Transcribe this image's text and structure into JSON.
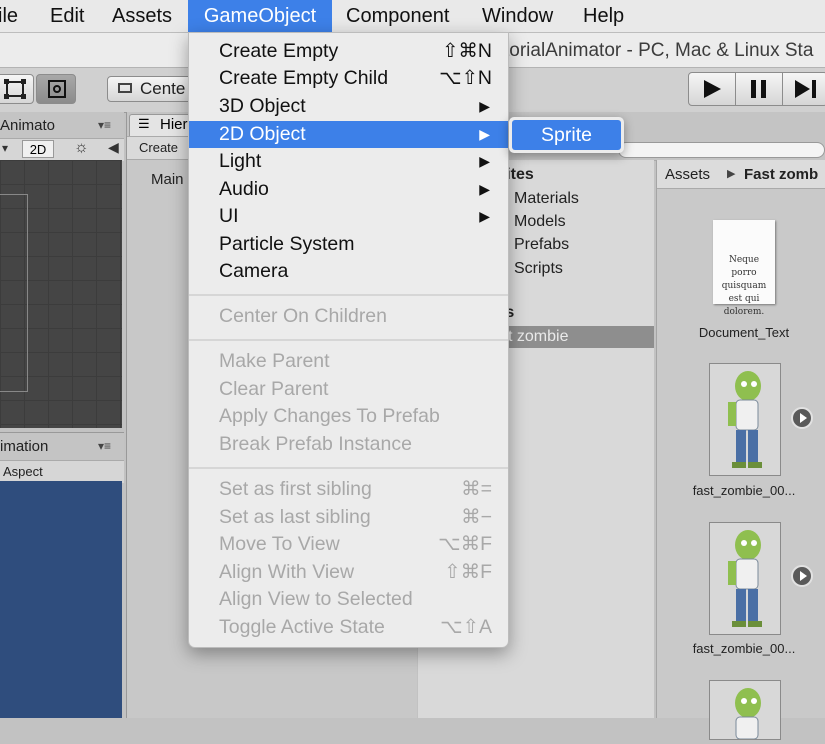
{
  "menubar": {
    "items": [
      "ile",
      "Edit",
      "Assets",
      "GameObject",
      "Component",
      "Window",
      "Help"
    ]
  },
  "window": {
    "title": "torialAnimator - PC, Mac & Linux Sta"
  },
  "toolbar": {
    "pivot_label": "Cente",
    "play_controls": [
      "play",
      "pause",
      "step"
    ]
  },
  "panels": {
    "animator_tab": "Animato",
    "animation_tab": "imation",
    "aspect_label": "Aspect",
    "scene_2d_button": "2D",
    "hierarchy_tab": "Hier",
    "hierarchy_create": "Create",
    "hierarchy_item": "Main"
  },
  "project": {
    "folders": [
      "rites",
      "Materials",
      "Models",
      "Prefabs",
      "Scripts",
      "ts",
      "st zombie"
    ],
    "breadcrumb": [
      "Assets",
      "Fast zomb"
    ],
    "assets": [
      {
        "name": "Document_Text",
        "preview_text": "Neque porro quisquam est qui dolorem."
      },
      {
        "name": "fast_zombie_00..."
      },
      {
        "name": "fast_zombie_00..."
      }
    ]
  },
  "gameobject_menu": {
    "items": [
      {
        "label": "Create Empty",
        "shortcut": "⇧⌘N",
        "enabled": true
      },
      {
        "label": "Create Empty Child",
        "shortcut": "⌥⇧N",
        "enabled": true
      },
      {
        "label": "3D Object",
        "submenu": true,
        "enabled": true
      },
      {
        "label": "2D Object",
        "submenu": true,
        "enabled": true,
        "highlighted": true
      },
      {
        "label": "Light",
        "submenu": true,
        "enabled": true
      },
      {
        "label": "Audio",
        "submenu": true,
        "enabled": true
      },
      {
        "label": "UI",
        "submenu": true,
        "enabled": true
      },
      {
        "label": "Particle System",
        "enabled": true
      },
      {
        "label": "Camera",
        "enabled": true
      },
      {
        "label": "Center On Children",
        "enabled": false
      },
      {
        "label": "Make Parent",
        "enabled": false
      },
      {
        "label": "Clear Parent",
        "enabled": false
      },
      {
        "label": "Apply Changes To Prefab",
        "enabled": false
      },
      {
        "label": "Break Prefab Instance",
        "enabled": false
      },
      {
        "label": "Set as first sibling",
        "shortcut": "⌘=",
        "enabled": false
      },
      {
        "label": "Set as last sibling",
        "shortcut": "⌘−",
        "enabled": false
      },
      {
        "label": "Move To View",
        "shortcut": "⌥⌘F",
        "enabled": false
      },
      {
        "label": "Align With View",
        "shortcut": "⇧⌘F",
        "enabled": false
      },
      {
        "label": "Align View to Selected",
        "enabled": false
      },
      {
        "label": "Toggle Active State",
        "shortcut": "⌥⇧A",
        "enabled": false
      }
    ],
    "submenu_arrow": "▶",
    "submenu_2d": [
      "Sprite"
    ]
  },
  "colors": {
    "menu_highlight": "#3d80e8",
    "disabled_text": "#a8a8a8"
  }
}
